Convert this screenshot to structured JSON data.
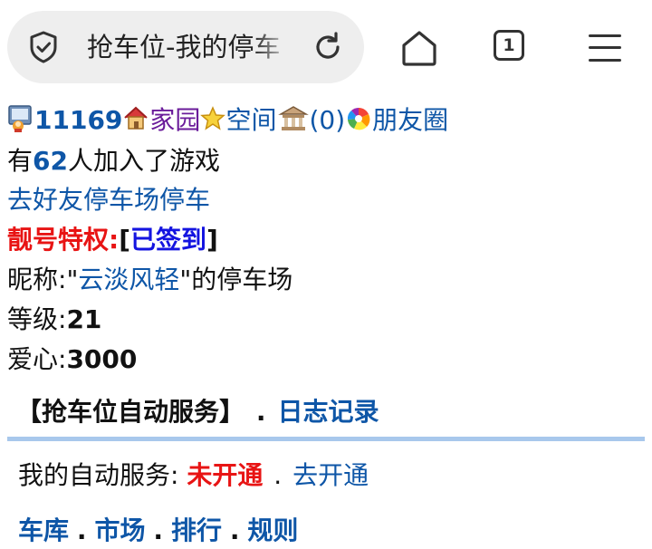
{
  "browser": {
    "url_text": "抢车位-我的停车",
    "tab_count": "1"
  },
  "status_row": {
    "user_id": "11169",
    "home_label": "家园",
    "space_label": "空间",
    "bank_count": "(0)",
    "moments_label": "朋友圈"
  },
  "players": {
    "prefix": "有",
    "count": "62",
    "suffix": "人加入了游戏"
  },
  "friends_link": "去好友停车场停车",
  "privilege": {
    "label": "靓号特权:",
    "bracket_open": "[",
    "signed_in": "已签到",
    "bracket_close": "]"
  },
  "nickname_row": {
    "prefix": "昵称:",
    "quote_open": "\"",
    "nickname": "云淡风轻",
    "quote_close": "\"",
    "suffix": "的停车场"
  },
  "level": {
    "label": "等级:",
    "value": "21"
  },
  "love": {
    "label": "爱心:",
    "value": "3000"
  },
  "auto_service": {
    "title": "【抢车位自动服务】",
    "dot": ".",
    "log_link": "日志记录"
  },
  "my_service": {
    "label": "我的自动服务:",
    "status": "未开通",
    "dot": ".",
    "open_link": "去开通"
  },
  "bottom_nav": {
    "items": [
      "车库",
      "市场",
      "排行",
      "规则"
    ],
    "dot": "."
  },
  "colors": {
    "link_blue": "#0e56a7",
    "alert_red": "#e81414",
    "signed_blue": "#1414e0",
    "divider": "#a8c8ec",
    "pill_bg": "#eeeeee"
  },
  "icons": [
    "shield-icon",
    "reload-icon",
    "home-icon",
    "tabs-icon",
    "menu-icon",
    "user-icon",
    "house-icon",
    "star-icon",
    "bank-icon",
    "aperture-icon"
  ]
}
